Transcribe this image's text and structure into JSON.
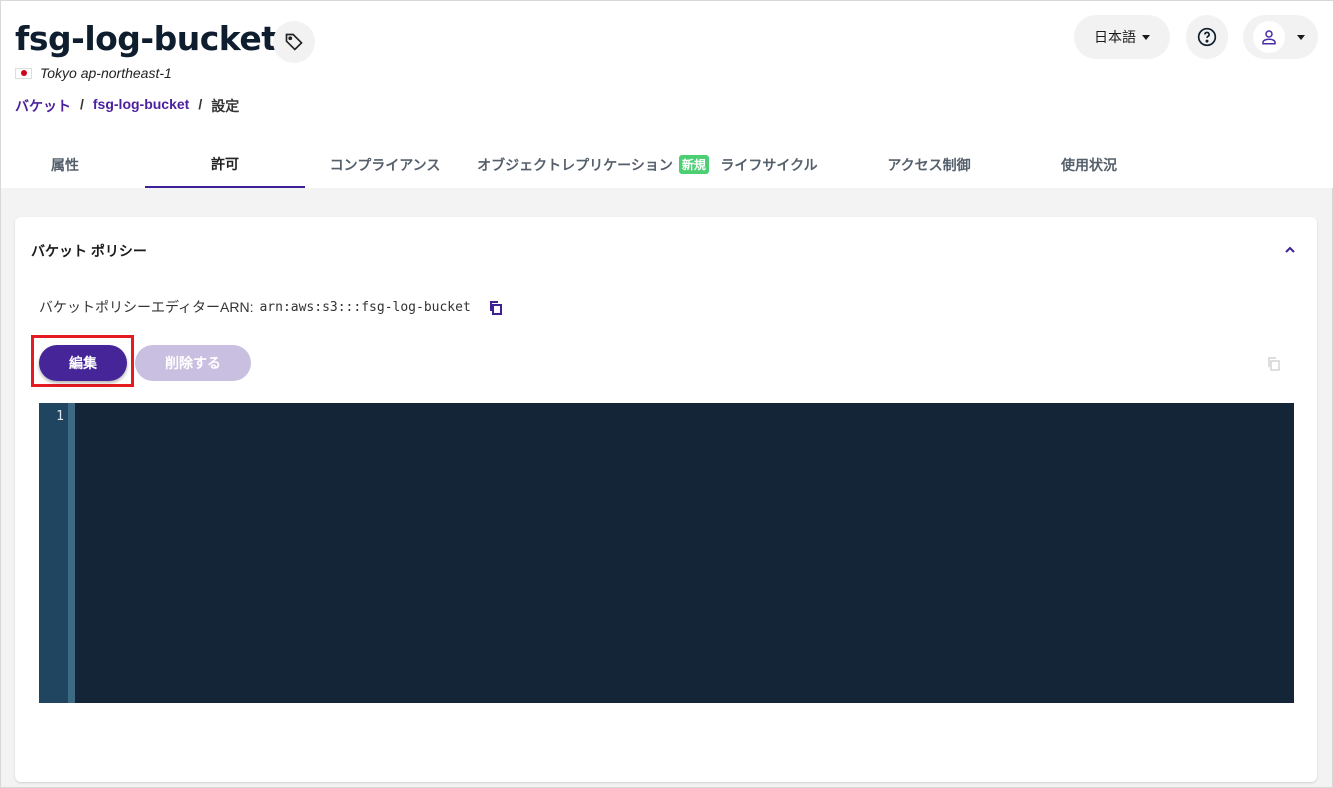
{
  "header": {
    "title": "fsg-log-bucket",
    "region": "Tokyo ap-northeast-1",
    "language": "日本語"
  },
  "breadcrumb": [
    "バケット",
    "fsg-log-bucket",
    "設定"
  ],
  "tabs": [
    {
      "label": "属性"
    },
    {
      "label": "許可"
    },
    {
      "label": "コンプライアンス"
    },
    {
      "label": "オブジェクトレプリケーション",
      "badge": "新規"
    },
    {
      "label": "ライフサイクル"
    },
    {
      "label": "アクセス制御"
    },
    {
      "label": "使用状況"
    }
  ],
  "policy": {
    "title": "バケット ポリシー",
    "arn_label": "バケットポリシーエディターARN:",
    "arn": "arn:aws:s3:::fsg-log-bucket",
    "edit": "編集",
    "delete": "削除する",
    "line_number": "1"
  },
  "colors": {
    "accent": "#452598",
    "highlight": "#e51b23"
  }
}
